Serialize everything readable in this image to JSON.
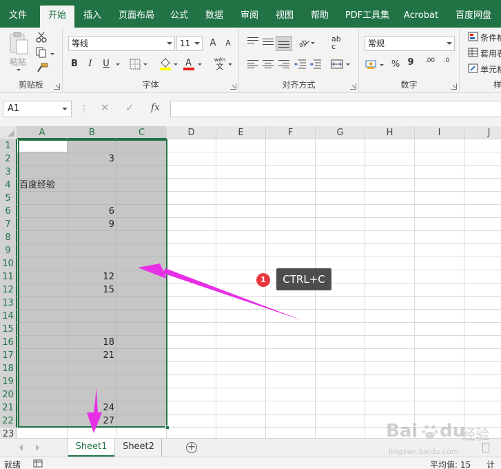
{
  "ribbon_tabs": [
    "文件",
    "开始",
    "插入",
    "页面布局",
    "公式",
    "数据",
    "审阅",
    "视图",
    "帮助",
    "PDF工具集",
    "Acrobat",
    "百度网盘"
  ],
  "active_tab": "开始",
  "clipboard": {
    "paste_label": "粘贴",
    "group_label": "剪贴板"
  },
  "font": {
    "name": "等线",
    "size": "11",
    "group_label": "字体",
    "bold": "B",
    "italic": "I",
    "underline": "U",
    "grow": "A",
    "shrink": "A",
    "phonetic_top": "wén",
    "phonetic_bottom": "文"
  },
  "alignment": {
    "group_label": "对齐方式",
    "wrap_top": "ab",
    "wrap_bottom": "c"
  },
  "number": {
    "format": "常规",
    "group_label": "数字",
    "percent": "%",
    "comma": "9",
    "inc_decimal": ".00",
    "dec_decimal": ".0"
  },
  "styles": {
    "items": [
      "条件格",
      "套用表",
      "单元格"
    ],
    "group_label": "样"
  },
  "formula_bar": {
    "name_box": "A1",
    "separator": "⋮",
    "cancel": "✕",
    "enter": "✓",
    "fx": "fx",
    "value": ""
  },
  "columns": [
    "A",
    "B",
    "C",
    "D",
    "E",
    "F",
    "G",
    "H",
    "I",
    "J"
  ],
  "rows": [
    {
      "n": "1",
      "a": "",
      "b": ""
    },
    {
      "n": "2",
      "a": "",
      "b": "3"
    },
    {
      "n": "3",
      "a": "",
      "b": ""
    },
    {
      "n": "4",
      "a": "百度经验",
      "b": ""
    },
    {
      "n": "5",
      "a": "",
      "b": ""
    },
    {
      "n": "6",
      "a": "",
      "b": "6"
    },
    {
      "n": "7",
      "a": "",
      "b": "9"
    },
    {
      "n": "8",
      "a": "",
      "b": ""
    },
    {
      "n": "9",
      "a": "",
      "b": ""
    },
    {
      "n": "10",
      "a": "",
      "b": ""
    },
    {
      "n": "11",
      "a": "",
      "b": "12"
    },
    {
      "n": "12",
      "a": "",
      "b": "15"
    },
    {
      "n": "13",
      "a": "",
      "b": ""
    },
    {
      "n": "14",
      "a": "",
      "b": ""
    },
    {
      "n": "15",
      "a": "",
      "b": ""
    },
    {
      "n": "16",
      "a": "",
      "b": "18"
    },
    {
      "n": "17",
      "a": "",
      "b": "21"
    },
    {
      "n": "18",
      "a": "",
      "b": ""
    },
    {
      "n": "19",
      "a": "",
      "b": ""
    },
    {
      "n": "20",
      "a": "",
      "b": ""
    },
    {
      "n": "21",
      "a": "",
      "b": "24"
    },
    {
      "n": "22",
      "a": "",
      "b": "27"
    },
    {
      "n": "23",
      "a": "",
      "b": ""
    }
  ],
  "annotation": {
    "badge": "1",
    "tip": "CTRL+C"
  },
  "sheets": [
    "Sheet1",
    "Sheet2"
  ],
  "active_sheet": "Sheet1",
  "add_sheet": "+",
  "status": {
    "ready": "就绪",
    "average": "平均值: 15",
    "count": "计数"
  },
  "watermark": {
    "brand": "Bai",
    "brand2": "du",
    "cn": "经验",
    "url": "jingyan.baidu.com"
  },
  "colors": {
    "accent": "#217346",
    "selection": "#c6c6c6",
    "arrow": "#e72fe6",
    "badge": "#e8383d",
    "tip_bg": "#4d4d4d"
  }
}
